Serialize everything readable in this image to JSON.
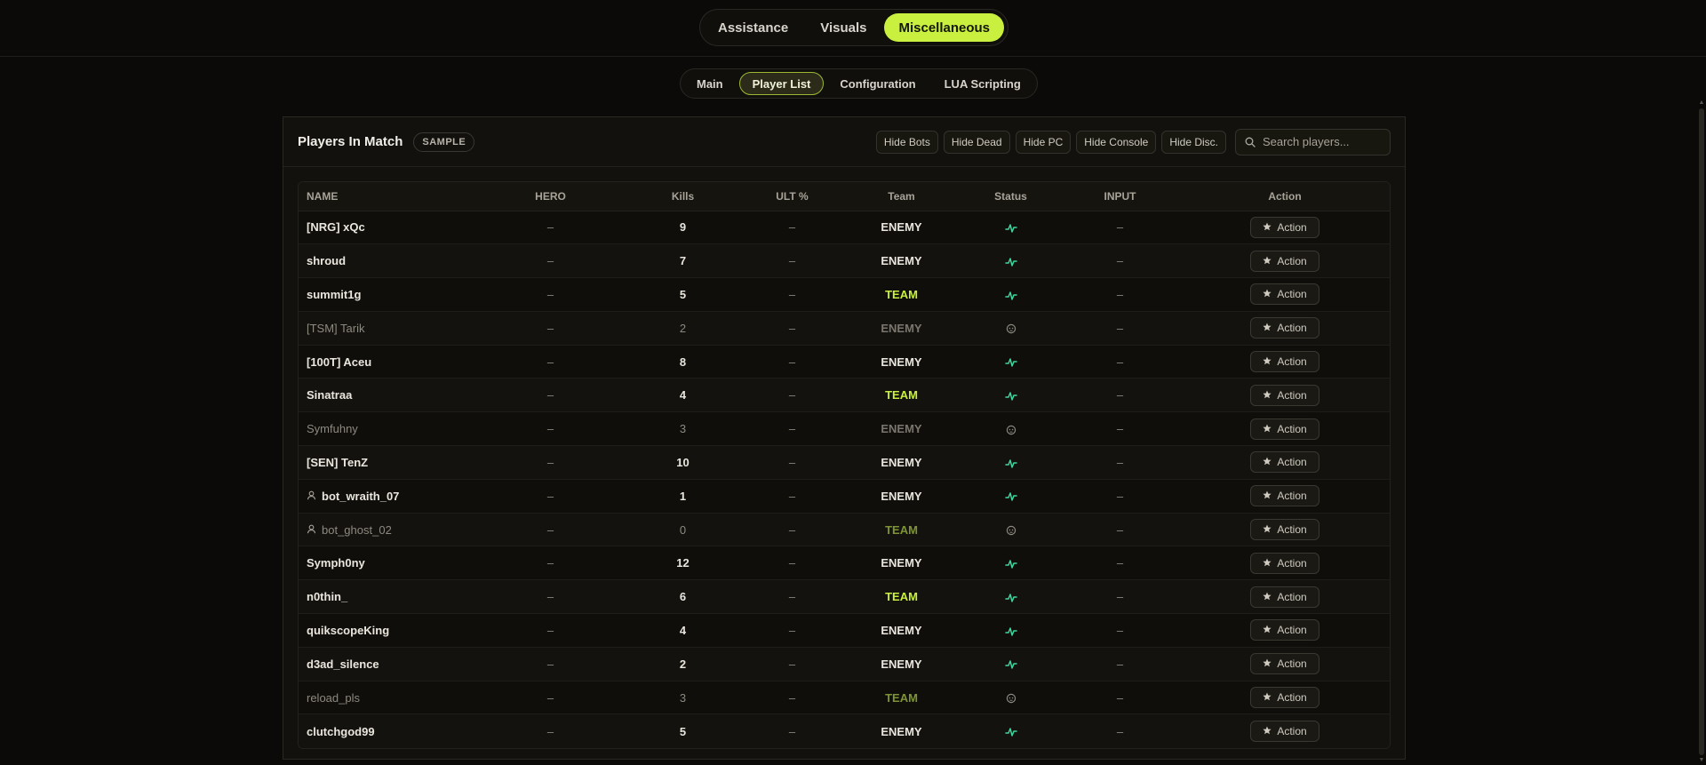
{
  "main_tabs": [
    {
      "label": "Assistance",
      "active": false
    },
    {
      "label": "Visuals",
      "active": false
    },
    {
      "label": "Miscellaneous",
      "active": true
    }
  ],
  "sub_tabs": [
    {
      "label": "Main",
      "active": false
    },
    {
      "label": "Player List",
      "active": true
    },
    {
      "label": "Configuration",
      "active": false
    },
    {
      "label": "LUA Scripting",
      "active": false
    }
  ],
  "panel": {
    "title": "Players In Match",
    "badge": "SAMPLE",
    "filters": [
      "Hide Bots",
      "Hide Dead",
      "Hide PC",
      "Hide Console",
      "Hide Disc."
    ],
    "search_placeholder": "Search players..."
  },
  "table": {
    "columns": [
      "NAME",
      "HERO",
      "Kills",
      "ULT %",
      "Team",
      "Status",
      "INPUT",
      "Action"
    ],
    "action_label": "Action",
    "empty_value": "–",
    "rows": [
      {
        "name": "[NRG] xQc",
        "kills": "9",
        "team": "ENEMY",
        "status": "alive",
        "bot": false
      },
      {
        "name": "shroud",
        "kills": "7",
        "team": "ENEMY",
        "status": "alive",
        "bot": false
      },
      {
        "name": "summit1g",
        "kills": "5",
        "team": "TEAM",
        "status": "alive",
        "bot": false
      },
      {
        "name": "[TSM] Tarik",
        "kills": "2",
        "team": "ENEMY",
        "status": "dead",
        "bot": false
      },
      {
        "name": "[100T] Aceu",
        "kills": "8",
        "team": "ENEMY",
        "status": "alive",
        "bot": false
      },
      {
        "name": "Sinatraa",
        "kills": "4",
        "team": "TEAM",
        "status": "alive",
        "bot": false
      },
      {
        "name": "Symfuhny",
        "kills": "3",
        "team": "ENEMY",
        "status": "dead",
        "bot": false
      },
      {
        "name": "[SEN] TenZ",
        "kills": "10",
        "team": "ENEMY",
        "status": "alive",
        "bot": false
      },
      {
        "name": "bot_wraith_07",
        "kills": "1",
        "team": "ENEMY",
        "status": "alive",
        "bot": true
      },
      {
        "name": "bot_ghost_02",
        "kills": "0",
        "team": "TEAM",
        "status": "dead",
        "bot": true
      },
      {
        "name": "Symph0ny",
        "kills": "12",
        "team": "ENEMY",
        "status": "alive",
        "bot": false
      },
      {
        "name": "n0thin_",
        "kills": "6",
        "team": "TEAM",
        "status": "alive",
        "bot": false
      },
      {
        "name": "quikscopeKing",
        "kills": "4",
        "team": "ENEMY",
        "status": "alive",
        "bot": false
      },
      {
        "name": "d3ad_silence",
        "kills": "2",
        "team": "ENEMY",
        "status": "alive",
        "bot": false
      },
      {
        "name": "reload_pls",
        "kills": "3",
        "team": "TEAM",
        "status": "dead",
        "bot": false
      },
      {
        "name": "clutchgod99",
        "kills": "5",
        "team": "ENEMY",
        "status": "alive",
        "bot": false
      }
    ]
  },
  "icons": {
    "alive": "pulse-icon",
    "dead": "skull-icon",
    "bot": "user-icon",
    "action": "star-icon",
    "search": "search-icon"
  },
  "colors": {
    "accent": "#c9f03f",
    "alive": "#3fd6a0",
    "background": "#0b0a08"
  }
}
